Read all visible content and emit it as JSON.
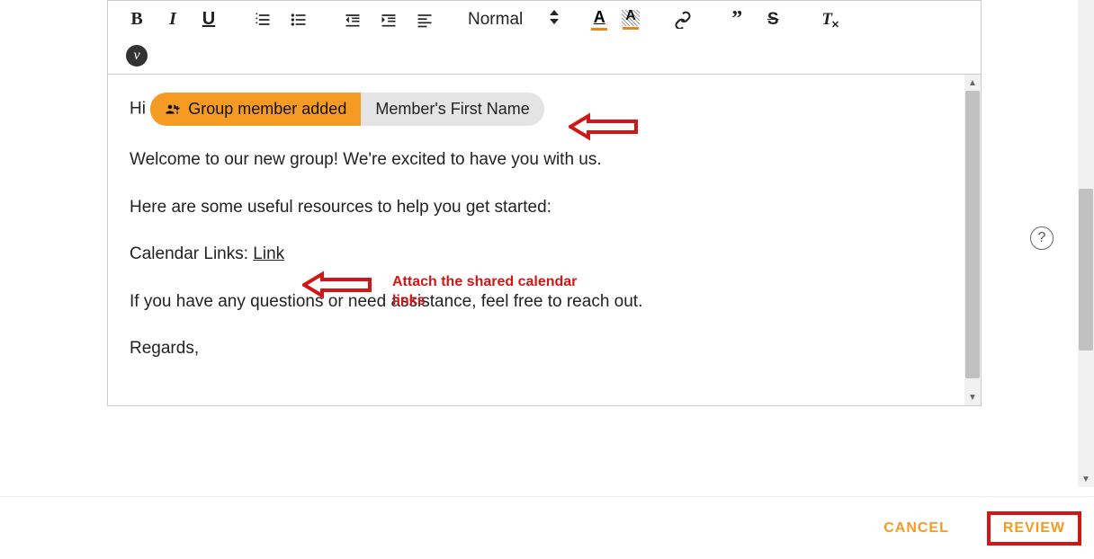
{
  "toolbar": {
    "format_label": "Normal"
  },
  "body": {
    "greeting": "Hi ",
    "pill_trigger": "Group member added",
    "pill_value": "Member's First Name",
    "line2": "Welcome to our new group! We're excited to have you with us.",
    "line3": "Here are some useful resources to help you get started:",
    "line4_prefix": "Calendar Links: ",
    "line4_link": "Link",
    "line5": "If you have any questions or need assistance, feel free to reach out.",
    "signoff": "Regards,"
  },
  "annotations": {
    "calendar_note": "Attach the shared calendar links"
  },
  "footer": {
    "cancel": "CANCEL",
    "review": "REVIEW"
  },
  "help": "?"
}
